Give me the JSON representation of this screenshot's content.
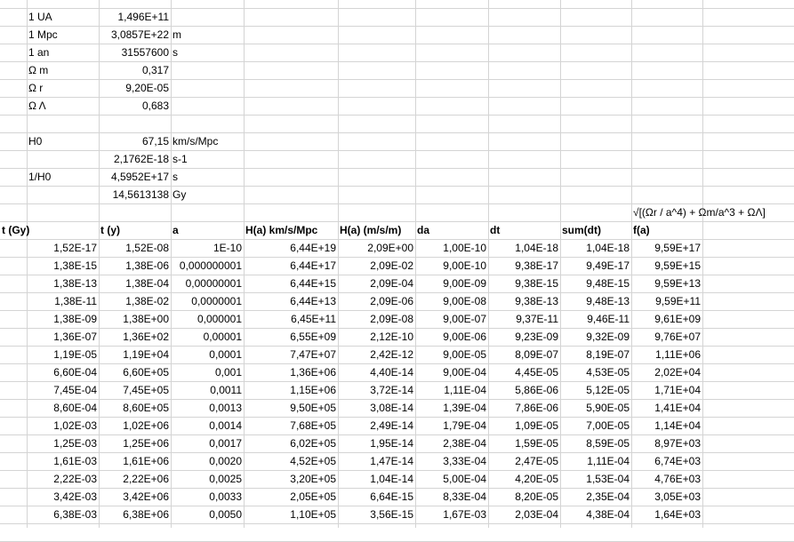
{
  "constants": [
    {
      "label": "1 UA",
      "value": "1,496E+11",
      "unit": ""
    },
    {
      "label": "1 Mpc",
      "value": "3,0857E+22",
      "unit": "m"
    },
    {
      "label": "1 an",
      "value": "31557600",
      "unit": "s"
    },
    {
      "label": "Ω m",
      "value": "0,317",
      "unit": ""
    },
    {
      "label": "Ω r",
      "value": "9,20E-05",
      "unit": ""
    },
    {
      "label": "Ω Λ",
      "value": "0,683",
      "unit": ""
    },
    {
      "label": "",
      "value": "",
      "unit": ""
    },
    {
      "label": "H0",
      "value": "67,15",
      "unit": "km/s/Mpc"
    },
    {
      "label": "",
      "value": "2,1762E-18",
      "unit": "s-1"
    },
    {
      "label": "1/H0",
      "value": "4,5952E+17",
      "unit": "s"
    },
    {
      "label": "",
      "value": "14,5613138",
      "unit": "Gy"
    }
  ],
  "formula_label": "√[(Ωr / a^4) + Ωm/a^3 + ΩΛ]",
  "headers": [
    "t (Gy)",
    "t (y)",
    "a",
    "H(a) km/s/Mpc",
    "H(a) (m/s/m)",
    "da",
    "dt",
    "sum(dt)",
    "f(a)"
  ],
  "rows": [
    [
      "1,52E-17",
      "1,52E-08",
      "1E-10",
      "6,44E+19",
      "2,09E+00",
      "1,00E-10",
      "1,04E-18",
      "1,04E-18",
      "9,59E+17"
    ],
    [
      "1,38E-15",
      "1,38E-06",
      "0,000000001",
      "6,44E+17",
      "2,09E-02",
      "9,00E-10",
      "9,38E-17",
      "9,49E-17",
      "9,59E+15"
    ],
    [
      "1,38E-13",
      "1,38E-04",
      "0,00000001",
      "6,44E+15",
      "2,09E-04",
      "9,00E-09",
      "9,38E-15",
      "9,48E-15",
      "9,59E+13"
    ],
    [
      "1,38E-11",
      "1,38E-02",
      "0,0000001",
      "6,44E+13",
      "2,09E-06",
      "9,00E-08",
      "9,38E-13",
      "9,48E-13",
      "9,59E+11"
    ],
    [
      "1,38E-09",
      "1,38E+00",
      "0,000001",
      "6,45E+11",
      "2,09E-08",
      "9,00E-07",
      "9,37E-11",
      "9,46E-11",
      "9,61E+09"
    ],
    [
      "1,36E-07",
      "1,36E+02",
      "0,00001",
      "6,55E+09",
      "2,12E-10",
      "9,00E-06",
      "9,23E-09",
      "9,32E-09",
      "9,76E+07"
    ],
    [
      "1,19E-05",
      "1,19E+04",
      "0,0001",
      "7,47E+07",
      "2,42E-12",
      "9,00E-05",
      "8,09E-07",
      "8,19E-07",
      "1,11E+06"
    ],
    [
      "6,60E-04",
      "6,60E+05",
      "0,001",
      "1,36E+06",
      "4,40E-14",
      "9,00E-04",
      "4,45E-05",
      "4,53E-05",
      "2,02E+04"
    ],
    [
      "7,45E-04",
      "7,45E+05",
      "0,0011",
      "1,15E+06",
      "3,72E-14",
      "1,11E-04",
      "5,86E-06",
      "5,12E-05",
      "1,71E+04"
    ],
    [
      "8,60E-04",
      "8,60E+05",
      "0,0013",
      "9,50E+05",
      "3,08E-14",
      "1,39E-04",
      "7,86E-06",
      "5,90E-05",
      "1,41E+04"
    ],
    [
      "1,02E-03",
      "1,02E+06",
      "0,0014",
      "7,68E+05",
      "2,49E-14",
      "1,79E-04",
      "1,09E-05",
      "7,00E-05",
      "1,14E+04"
    ],
    [
      "1,25E-03",
      "1,25E+06",
      "0,0017",
      "6,02E+05",
      "1,95E-14",
      "2,38E-04",
      "1,59E-05",
      "8,59E-05",
      "8,97E+03"
    ],
    [
      "1,61E-03",
      "1,61E+06",
      "0,0020",
      "4,52E+05",
      "1,47E-14",
      "3,33E-04",
      "2,47E-05",
      "1,11E-04",
      "6,74E+03"
    ],
    [
      "2,22E-03",
      "2,22E+06",
      "0,0025",
      "3,20E+05",
      "1,04E-14",
      "5,00E-04",
      "4,20E-05",
      "1,53E-04",
      "4,76E+03"
    ],
    [
      "3,42E-03",
      "3,42E+06",
      "0,0033",
      "2,05E+05",
      "6,64E-15",
      "8,33E-04",
      "8,20E-05",
      "2,35E-04",
      "3,05E+03"
    ],
    [
      "6,38E-03",
      "6,38E+06",
      "0,0050",
      "1,10E+05",
      "3,56E-15",
      "1,67E-03",
      "2,03E-04",
      "4,38E-04",
      "1,64E+03"
    ]
  ]
}
